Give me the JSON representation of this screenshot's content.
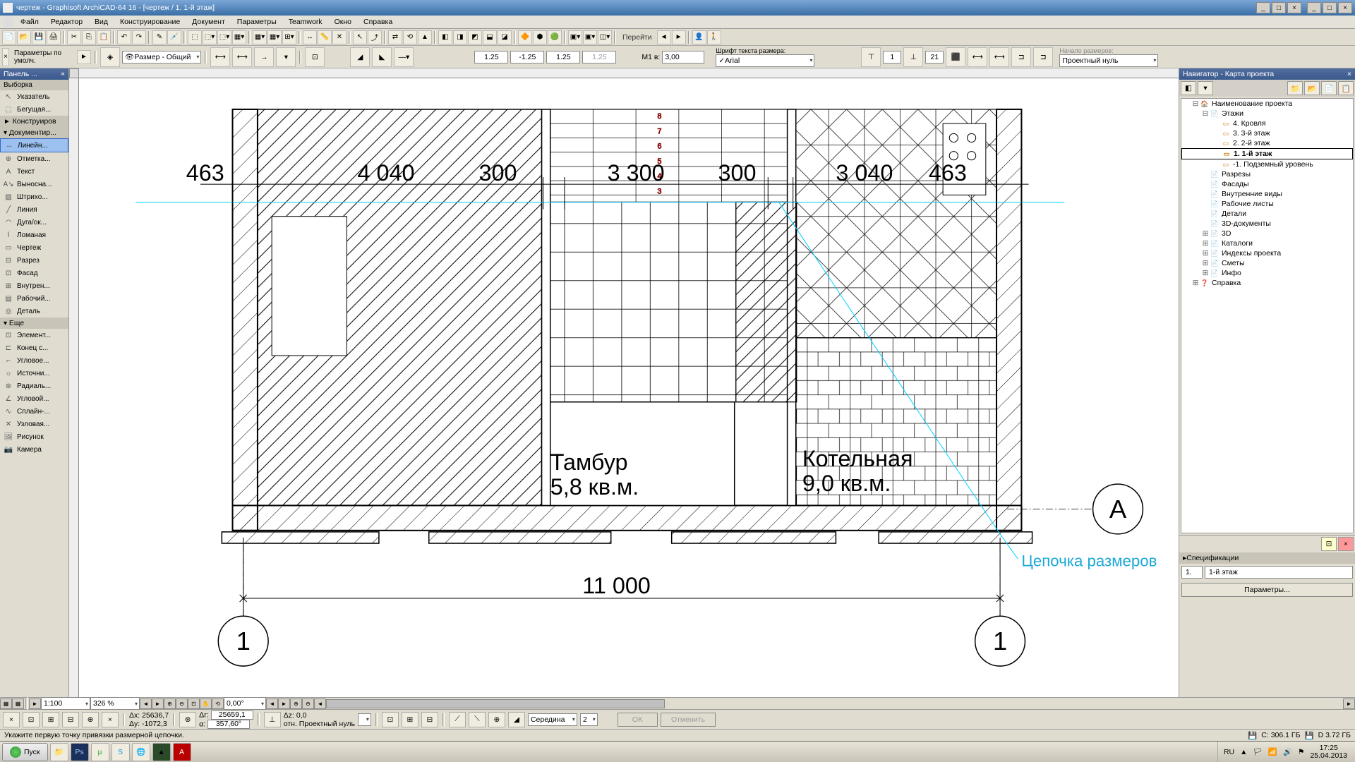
{
  "title": "чертеж - Graphisoft ArchiCAD-64 16 - [чертеж / 1. 1-й этаж]",
  "menu": [
    "Файл",
    "Редактор",
    "Вид",
    "Конструирование",
    "Документ",
    "Параметры",
    "Teamwork",
    "Окно",
    "Справка"
  ],
  "toolbar2": {
    "params_label": "Параметры по умолч.",
    "layer_label": "Размер - Общий",
    "dim_top": "1.25",
    "dim_off": "-1.25",
    "dim_ext": "1.25",
    "dim_gap": "1.25",
    "scale_label": "M1 в:",
    "scale_val": "3,00",
    "font_label": "Шрифт текста размера:",
    "font_val": "Arial",
    "num1": "1",
    "num2": "21"
  },
  "goto": "Перейти",
  "origin_label": "Проектный нуль",
  "origin_hdr": "Начало размеров:",
  "leftpanel": {
    "title": "Панель ...",
    "sec1": "Выборка",
    "sec2": "Конструиров",
    "sec3": "Документир...",
    "sec4": "Еще",
    "items1": [
      "Указатель",
      "Бегущая..."
    ],
    "items3": [
      "Линейн...",
      "Отметка...",
      "Текст",
      "Выносна...",
      "Штрихо...",
      "Линия",
      "Дуга/ок...",
      "Ломаная",
      "Чертеж",
      "Разрез",
      "Фасад",
      "Внутрен...",
      "Рабочий...",
      "Деталь"
    ],
    "items4": [
      "Элемент...",
      "Конец с...",
      "Угловое...",
      "Источни...",
      "Радиаль...",
      "Угловой...",
      "Сплайн-...",
      "Узловая...",
      "Рисунок",
      "Камера"
    ]
  },
  "nav": {
    "title": "Навигатор - Карта проекта",
    "root": "Наименование проекта",
    "floors_root": "Этажи",
    "floors": [
      "4. Кровля",
      "3. 3-й этаж",
      "2. 2-й этаж",
      "1. 1-й этаж",
      "-1. Подземный уровень"
    ],
    "items": [
      "Разрезы",
      "Фасады",
      "Внутренние виды",
      "Рабочие листы",
      "Детали",
      "3D-документы",
      "3D",
      "Каталоги",
      "Индексы проекта",
      "Сметы",
      "Инфо",
      "Справка"
    ]
  },
  "spec": {
    "hdr": "Спецификации",
    "row": "1.",
    "val": "1-й этаж",
    "btn": "Параметры..."
  },
  "bottombar": {
    "scale": "1:100",
    "zoom": "326 %",
    "angle": "0,00°",
    "dx": "Δx: 25636,7",
    "dy": "Δy: -1072,3",
    "dr_lbl": "Δг:",
    "dr_val": "25659,1",
    "da_lbl": "α:",
    "da_val": "357,60°",
    "dz": "Δz: 0,0",
    "rel": "отн. Проектный нуль",
    "snap": "Середина",
    "snapnum": "2",
    "ok": "OK",
    "cancel": "Отменить"
  },
  "hint": "Укажите первую точку привязки размерной цепочки.",
  "disk": {
    "c": "C: 306.1 ГБ",
    "d": "D 3.72 ГБ"
  },
  "taskbar": {
    "start": "Пуск",
    "lang": "RU",
    "time": "17:25",
    "date": "25.04.2013"
  },
  "drawing": {
    "dims_top": [
      "463",
      "4 040",
      "300",
      "3 300",
      "300",
      "3 040",
      "463"
    ],
    "dim_total": "11 000",
    "room1_name": "Тамбур",
    "room1_area": "5,8 кв.м.",
    "room2_name": "Котельная",
    "room2_area": "9,0 кв.м.",
    "axis_A": "А",
    "axis_1": "1",
    "annotation": "Цепочка размеров"
  }
}
